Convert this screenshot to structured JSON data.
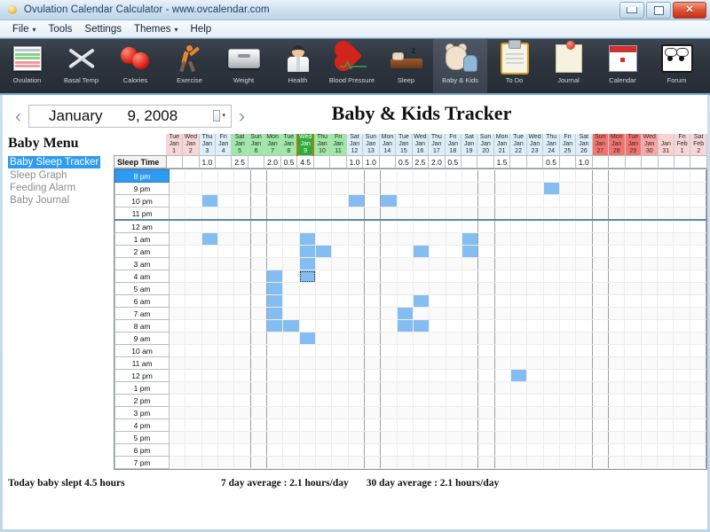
{
  "window": {
    "title": "Ovulation Calendar Calculator - www.ovcalendar.com",
    "icon": "sun-icon",
    "minimize": "minimize-button",
    "maximize": "maximize-button",
    "close": "close-button"
  },
  "menubar": {
    "items": [
      {
        "label": "File",
        "caret": "▾"
      },
      {
        "label": "Tools",
        "caret": ""
      },
      {
        "label": "Settings",
        "caret": ""
      },
      {
        "label": "Themes",
        "caret": "▾"
      },
      {
        "label": "Help",
        "caret": ""
      }
    ]
  },
  "toolbar": {
    "buttons": [
      {
        "label": "Ovulation",
        "icon": "calendar-ovulation-icon"
      },
      {
        "label": "Basal Temp",
        "icon": "crossed-thermometers-icon"
      },
      {
        "label": "Calories",
        "icon": "apples-icon"
      },
      {
        "label": "Exercise",
        "icon": "stretching-person-icon"
      },
      {
        "label": "Weight",
        "icon": "scale-icon"
      },
      {
        "label": "Health",
        "icon": "doctor-icon"
      },
      {
        "label": "Blood Pressure",
        "icon": "heart-ekg-icon"
      },
      {
        "label": "Sleep",
        "icon": "bed-icon"
      },
      {
        "label": "Baby & Kids",
        "icon": "teddy-bear-icon",
        "selected": true
      },
      {
        "label": "To Do",
        "icon": "clipboard-icon"
      },
      {
        "label": "Journal",
        "icon": "notepad-pin-icon"
      },
      {
        "label": "Calendar",
        "icon": "calendar-icon"
      },
      {
        "label": "Forum",
        "icon": "speech-bubbles-icon"
      }
    ]
  },
  "datebar": {
    "prev": "‹",
    "next": "›",
    "month": "January",
    "day_year": "9, 2008",
    "dropdown_icon": "date-picker-icon"
  },
  "page": {
    "title": "Baby & Kids Tracker"
  },
  "sidebar": {
    "title": "Baby Menu",
    "items": [
      {
        "label": "Baby Sleep Tracker",
        "active": true
      },
      {
        "label": "Sleep Graph",
        "active": false
      },
      {
        "label": "Feeding Alarm",
        "active": false
      },
      {
        "label": "Baby Journal",
        "active": false
      }
    ]
  },
  "grid": {
    "row_label": "Sleep Time",
    "time_rows": [
      "8 pm",
      "9 pm",
      "10 pm",
      "11 pm",
      "12 am",
      "1 am",
      "2 am",
      "3 am",
      "4 am",
      "5 am",
      "6 am",
      "7 am",
      "8 am",
      "9 am",
      "10 am",
      "11 am",
      "12 pm",
      "1 pm",
      "2 pm",
      "3 pm",
      "4 pm",
      "5 pm",
      "6 pm",
      "7 pm"
    ],
    "selected_time_row": "8 pm",
    "midline_after_row": "11 pm",
    "columns": [
      {
        "dow": "Tue",
        "mon": "Jan",
        "day": "1",
        "tint": "pink"
      },
      {
        "dow": "Wed",
        "mon": "Jan",
        "day": "2",
        "tint": "pink"
      },
      {
        "dow": "Thu",
        "mon": "Jan",
        "day": "3",
        "tint": "blue"
      },
      {
        "dow": "Fri",
        "mon": "Jan",
        "day": "4",
        "tint": "blue"
      },
      {
        "dow": "Sat",
        "mon": "Jan",
        "day": "5",
        "tint": "green"
      },
      {
        "dow": "Sun",
        "mon": "Jan",
        "day": "6",
        "tint": "green"
      },
      {
        "dow": "Mon",
        "mon": "Jan",
        "day": "7",
        "tint": "green"
      },
      {
        "dow": "Tue",
        "mon": "Jan",
        "day": "8",
        "tint": "green"
      },
      {
        "dow": "Wed",
        "mon": "Jan",
        "day": "9",
        "tint": "today"
      },
      {
        "dow": "Thu",
        "mon": "Jan",
        "day": "10",
        "tint": "green"
      },
      {
        "dow": "Fri",
        "mon": "Jan",
        "day": "11",
        "tint": "green"
      },
      {
        "dow": "Sat",
        "mon": "Jan",
        "day": "12",
        "tint": "blue"
      },
      {
        "dow": "Sun",
        "mon": "Jan",
        "day": "13",
        "tint": "blue"
      },
      {
        "dow": "Mon",
        "mon": "Jan",
        "day": "14",
        "tint": "blue"
      },
      {
        "dow": "Tue",
        "mon": "Jan",
        "day": "15",
        "tint": "blue"
      },
      {
        "dow": "Wed",
        "mon": "Jan",
        "day": "16",
        "tint": "blue"
      },
      {
        "dow": "Thu",
        "mon": "Jan",
        "day": "17",
        "tint": "blue"
      },
      {
        "dow": "Fri",
        "mon": "Jan",
        "day": "18",
        "tint": "blue"
      },
      {
        "dow": "Sat",
        "mon": "Jan",
        "day": "19",
        "tint": "blue"
      },
      {
        "dow": "Sun",
        "mon": "Jan",
        "day": "20",
        "tint": "blue"
      },
      {
        "dow": "Mon",
        "mon": "Jan",
        "day": "21",
        "tint": "blue"
      },
      {
        "dow": "Tue",
        "mon": "Jan",
        "day": "22",
        "tint": "blue"
      },
      {
        "dow": "Wed",
        "mon": "Jan",
        "day": "23",
        "tint": "blue"
      },
      {
        "dow": "Thu",
        "mon": "Jan",
        "day": "24",
        "tint": "blue"
      },
      {
        "dow": "Fri",
        "mon": "Jan",
        "day": "25",
        "tint": "blue"
      },
      {
        "dow": "Sat",
        "mon": "Jan",
        "day": "26",
        "tint": "blue"
      },
      {
        "dow": "Sun",
        "mon": "Jan",
        "day": "27",
        "tint": "red"
      },
      {
        "dow": "Mon",
        "mon": "Jan",
        "day": "28",
        "tint": "red"
      },
      {
        "dow": "Tue",
        "mon": "Jan",
        "day": "29",
        "tint": "red"
      },
      {
        "dow": "Wed",
        "mon": "Jan",
        "day": "30",
        "tint": "red2"
      },
      {
        "dow": "",
        "mon": "Jan",
        "day": "31",
        "tint": "red3"
      },
      {
        "dow": "Fri",
        "mon": "Feb",
        "day": "1",
        "tint": "pink"
      },
      {
        "dow": "Sat",
        "mon": "Feb",
        "day": "2",
        "tint": "pink"
      }
    ],
    "hours_values": [
      "",
      "",
      "1.0",
      "",
      "2.5",
      "",
      "2.0",
      "0.5",
      "4.5",
      "",
      "",
      "1.0",
      "1.0",
      "",
      "0.5",
      "2.5",
      "2.0",
      "0.5",
      "",
      "",
      "1.5",
      "",
      "",
      "0.5",
      "",
      "1.0",
      "",
      "",
      "",
      "",
      "",
      "",
      ""
    ],
    "sleep_blocks": [
      {
        "col": 2,
        "row": 2,
        "span": 1
      },
      {
        "col": 2,
        "row": 5,
        "span": 1
      },
      {
        "col": 6,
        "row": 8,
        "span": 1
      },
      {
        "col": 6,
        "row": 9,
        "span": 1
      },
      {
        "col": 6,
        "row": 10,
        "span": 1
      },
      {
        "col": 6,
        "row": 11,
        "span": 1
      },
      {
        "col": 6,
        "row": 12,
        "span": 1
      },
      {
        "col": 7,
        "row": 12,
        "span": 1
      },
      {
        "col": 8,
        "row": 5,
        "span": 3
      },
      {
        "col": 8,
        "row": 8,
        "span": 1,
        "focus": true
      },
      {
        "col": 8,
        "row": 13,
        "span": 1
      },
      {
        "col": 9,
        "row": 6,
        "span": 1
      },
      {
        "col": 11,
        "row": 2,
        "span": 1
      },
      {
        "col": 13,
        "row": 2,
        "span": 1
      },
      {
        "col": 15,
        "row": 6,
        "span": 1
      },
      {
        "col": 15,
        "row": 10,
        "span": 1
      },
      {
        "col": 14,
        "row": 11,
        "span": 2
      },
      {
        "col": 15,
        "row": 12,
        "span": 1
      },
      {
        "col": 18,
        "row": 5,
        "span": 2
      },
      {
        "col": 23,
        "row": 1,
        "span": 1
      },
      {
        "col": 21,
        "row": 16,
        "span": 1
      }
    ]
  },
  "status": {
    "today": "Today baby slept 4.5 hours",
    "avg7": "7 day average : 2.1 hours/day",
    "avg30": "30 day average : 2.1 hours/day"
  }
}
